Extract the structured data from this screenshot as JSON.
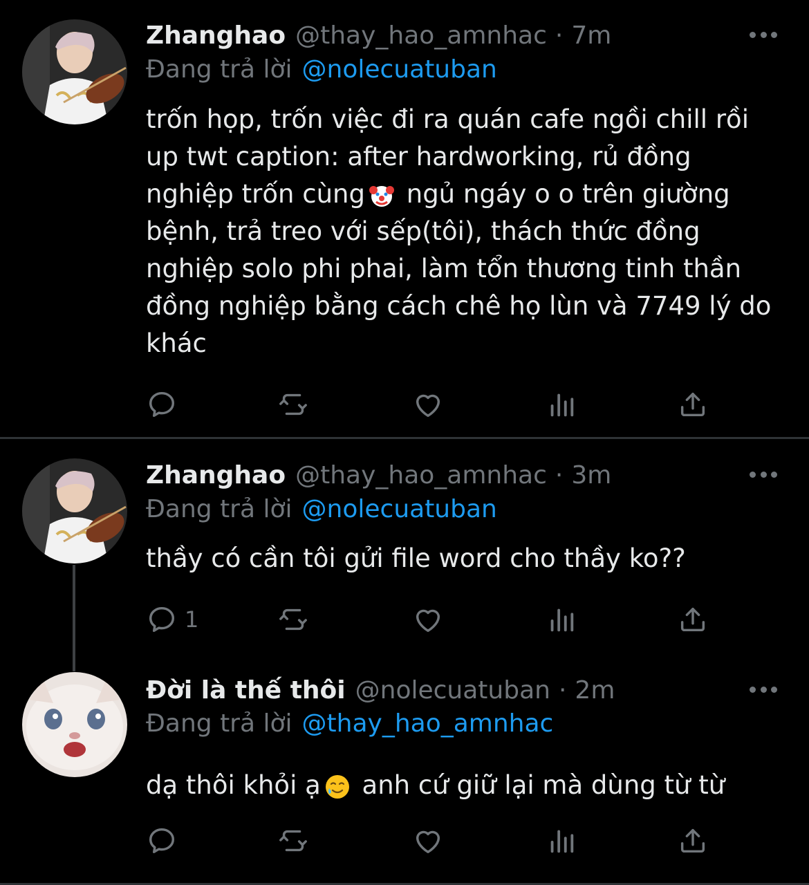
{
  "tweets": [
    {
      "name": "Zhanghao",
      "handle": "@thay_hao_amnhac",
      "separator": "·",
      "time": "7m",
      "replying_label": "Đang trả lời",
      "replying_to": "@nolecuatuban",
      "text_before_emoji": "trốn họp, trốn việc đi ra quán cafe ngồi chill rồi up twt caption: after hardworking, rủ đồng nghiệp trốn cùng",
      "emoji": "clown-face",
      "text_after_emoji": " ngủ ngáy o o trên giường bệnh, trả treo với sếp(tôi), thách thức đồng nghiệp solo phi phai, làm tổn thương tinh thần đồng nghiệp bằng cách chê họ lùn và 7749 lý do khác",
      "reply_count": ""
    },
    {
      "name": "Zhanghao",
      "handle": "@thay_hao_amnhac",
      "separator": "·",
      "time": "3m",
      "replying_label": "Đang trả lời",
      "replying_to": "@nolecuatuban",
      "text": "thầy có cần tôi gửi file word cho thầy ko??",
      "reply_count": "1"
    },
    {
      "name": "Đời là thế thôi",
      "handle": "@nolecuatuban",
      "separator": "·",
      "time": "2m",
      "replying_label": "Đang trả lời",
      "replying_to": "@thay_hao_amnhac",
      "text_before_emoji": "dạ thôi khỏi ạ",
      "emoji": "smiling-face-with-tear",
      "text_after_emoji": " anh cứ giữ lại mà dùng từ từ",
      "reply_count": ""
    }
  ],
  "icons": [
    "reply-icon",
    "retweet-icon",
    "like-icon",
    "views-icon",
    "share-icon",
    "more-icon"
  ],
  "colors": {
    "background": "#000000",
    "text": "#e7e9ea",
    "muted": "#71767b",
    "link": "#1d9bf0",
    "divider": "#2f3336"
  }
}
